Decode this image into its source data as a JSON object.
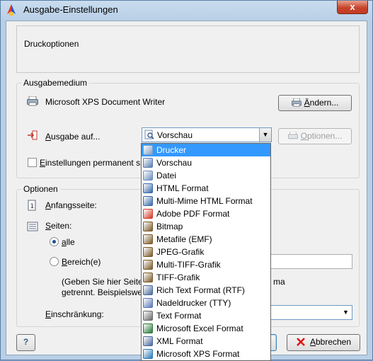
{
  "window": {
    "title": "Ausgabe-Einstellungen",
    "close_label": "x"
  },
  "header_panel": {
    "title": "Druckoptionen"
  },
  "ausgabemedium": {
    "legend": "Ausgabemedium",
    "printer_name": "Microsoft XPS Document Writer",
    "change_button": "Ändern...",
    "output_label": "Ausgabe auf...",
    "output_selected": "Vorschau",
    "options_button": "Optionen...",
    "permanent_checkbox_label": "Einstellungen permanent sp",
    "permanent_checked": false
  },
  "optionen": {
    "legend": "Optionen",
    "start_page_label": "Anfangsseite:",
    "pages_label": "Seiten:",
    "radio_all": "alle",
    "radio_range": "Bereich(e)",
    "help_text_line1_left": "(Geben Sie hier Seiten",
    "help_text_line1_right": "ma",
    "help_text_line2": "getrennt. Beispielswei",
    "restriction_label": "Einschränkung:"
  },
  "footer": {
    "help_label": "?",
    "cancel_label": "Abbrechen"
  },
  "dropdown": {
    "items": [
      {
        "label": "Drucker",
        "icon": "printer-icon",
        "color": "#7fa0c4",
        "selected": true
      },
      {
        "label": "Vorschau",
        "icon": "preview-icon",
        "color": "#5a7fb0"
      },
      {
        "label": "Datei",
        "icon": "file-icon",
        "color": "#6b8ebd"
      },
      {
        "label": "HTML Format",
        "icon": "html-icon",
        "color": "#3c6aa8"
      },
      {
        "label": "Multi-Mime HTML Format",
        "icon": "mhtml-icon",
        "color": "#3c6aa8"
      },
      {
        "label": "Adobe PDF Format",
        "icon": "pdf-icon",
        "color": "#d43a2a"
      },
      {
        "label": "Bitmap",
        "icon": "bitmap-icon",
        "color": "#7b5a2a"
      },
      {
        "label": "Metafile (EMF)",
        "icon": "emf-icon",
        "color": "#7b5a2a"
      },
      {
        "label": "JPEG-Grafik",
        "icon": "jpeg-icon",
        "color": "#7b5a2a"
      },
      {
        "label": "Multi-TIFF-Grafik",
        "icon": "multi-tiff-icon",
        "color": "#7b5a2a"
      },
      {
        "label": "TIFF-Grafik",
        "icon": "tiff-icon",
        "color": "#7b5a2a"
      },
      {
        "label": "Rich Text Format (RTF)",
        "icon": "rtf-icon",
        "color": "#4a6a9a"
      },
      {
        "label": "Nadeldrucker (TTY)",
        "icon": "dot-matrix-icon",
        "color": "#5b79b5"
      },
      {
        "label": "Text Format",
        "icon": "text-icon",
        "color": "#6a6a6a"
      },
      {
        "label": "Microsoft Excel Format",
        "icon": "excel-icon",
        "color": "#2a7a3a"
      },
      {
        "label": "XML Format",
        "icon": "xml-icon",
        "color": "#4a6a9a"
      },
      {
        "label": "Microsoft XPS Format",
        "icon": "xps-icon",
        "color": "#2a7ab5"
      }
    ]
  }
}
